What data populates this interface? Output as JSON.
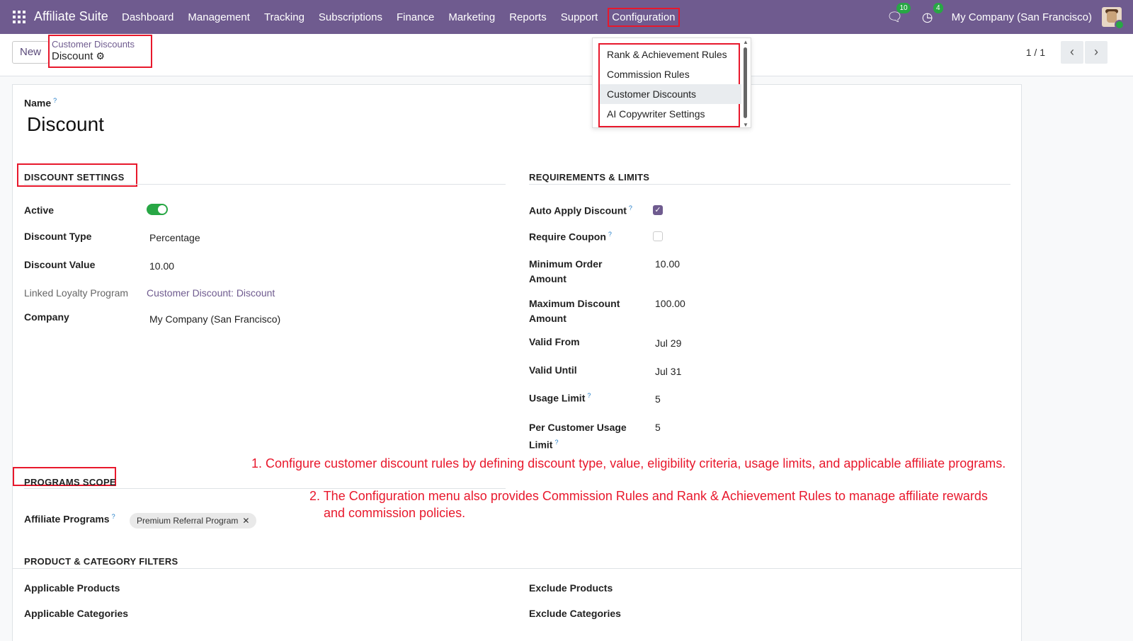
{
  "topbar": {
    "brand": "Affiliate Suite",
    "menu": [
      "Dashboard",
      "Management",
      "Tracking",
      "Subscriptions",
      "Finance",
      "Marketing",
      "Reports",
      "Support",
      "Configuration"
    ],
    "messages_count": "10",
    "activities_count": "4",
    "company": "My Company (San Francisco)"
  },
  "control": {
    "new_label": "New",
    "breadcrumb_parent": "Customer Discounts",
    "breadcrumb_current": "Discount",
    "pager": "1 / 1"
  },
  "dropdown": {
    "items": [
      "Rank & Achievement Rules",
      "Commission Rules",
      "Customer Discounts",
      "AI Copywriter Settings"
    ]
  },
  "form": {
    "name_label": "Name",
    "name_value": "Discount",
    "discount_settings": {
      "title": "DISCOUNT SETTINGS",
      "active_label": "Active",
      "active": true,
      "type_label": "Discount Type",
      "type_value": "Percentage",
      "value_label": "Discount Value",
      "value_value": "10.00",
      "loyalty_label": "Linked Loyalty Program",
      "loyalty_value": "Customer Discount: Discount",
      "company_label": "Company",
      "company_value": "My Company (San Francisco)"
    },
    "requirements": {
      "title": "REQUIREMENTS & LIMITS",
      "auto_apply_label": "Auto Apply Discount",
      "auto_apply": true,
      "require_coupon_label": "Require Coupon",
      "require_coupon": false,
      "min_order_label_1": "Minimum Order",
      "min_order_label_2": "Amount",
      "min_order_value": "10.00",
      "max_discount_label_1": "Maximum Discount",
      "max_discount_label_2": "Amount",
      "max_discount_value": "100.00",
      "valid_from_label": "Valid From",
      "valid_from_value": "Jul 29",
      "valid_until_label": "Valid Until",
      "valid_until_value": "Jul 31",
      "usage_limit_label": "Usage Limit",
      "usage_limit_value": "5",
      "per_customer_label_1": "Per Customer Usage",
      "per_customer_label_2": "Limit",
      "per_customer_value": "5"
    },
    "programs_scope": {
      "title": "PROGRAMS SCOPE",
      "affiliate_programs_label": "Affiliate Programs",
      "tag": "Premium Referral Program"
    },
    "filters": {
      "title": "PRODUCT & CATEGORY FILTERS",
      "applicable_products": "Applicable Products",
      "exclude_products": "Exclude Products",
      "applicable_categories": "Applicable Categories",
      "exclude_categories": "Exclude Categories"
    }
  },
  "annotations": {
    "note1": "1. Configure customer discount rules by defining discount type, value, eligibility criteria, usage limits, and applicable affiliate programs.",
    "note2_line1": "2. The Configuration menu also provides Commission Rules and Rank & Achievement Rules to manage affiliate rewards",
    "note2_line2": "and commission policies."
  },
  "colors": {
    "brand": "#6f5b8f",
    "annotation": "#e8182c",
    "toggle_on": "#28a745"
  }
}
